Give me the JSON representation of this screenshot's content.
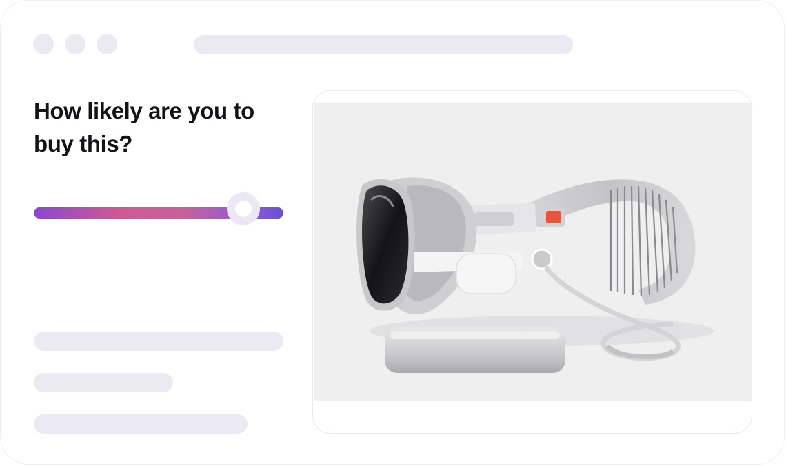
{
  "window": {
    "controls": [
      "close-dot",
      "minimize-dot",
      "maximize-dot"
    ]
  },
  "survey": {
    "question": "How likely are you to buy this?",
    "slider": {
      "value": 0.84,
      "gradient_colors": [
        "#8b47cf",
        "#cf5a92",
        "#6a50d6"
      ]
    }
  },
  "product_image": {
    "subject": "vr-headset-with-battery-pack"
  },
  "colors": {
    "placeholder": "#ebeaf2",
    "heading": "#121217",
    "accent": "#e8553b"
  }
}
